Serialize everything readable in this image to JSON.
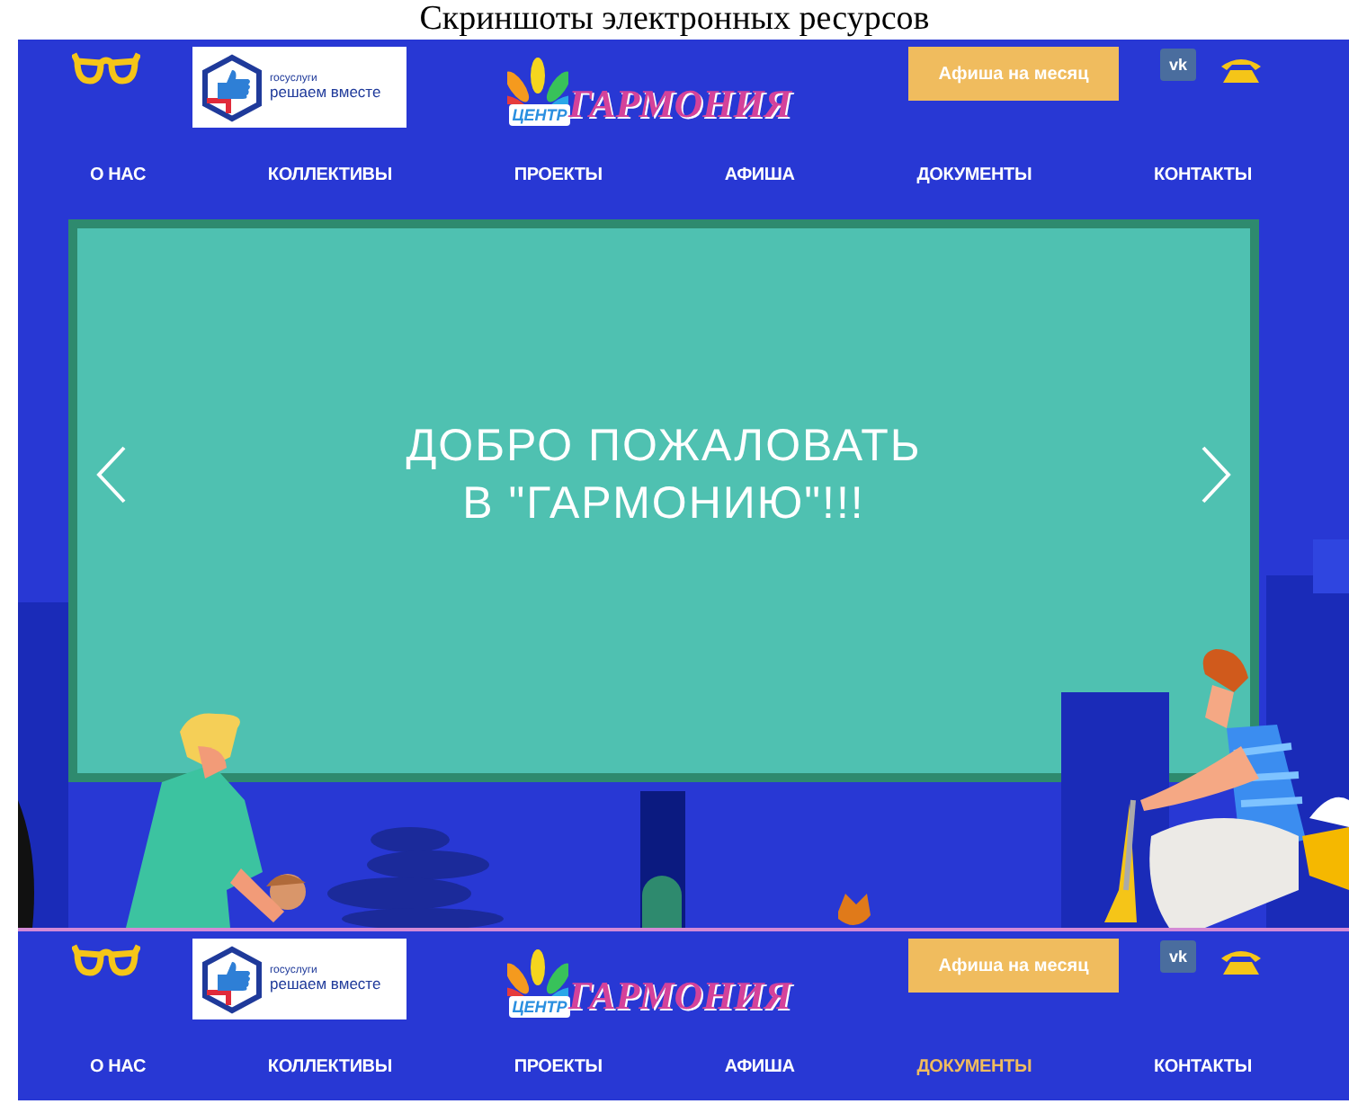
{
  "caption": "Скриншоты электронных ресурсов",
  "screenshots": [
    {
      "header": {
        "partner_logo": {
          "brand": "госуслуги",
          "slogan": "решаем вместе"
        },
        "site_logo": {
          "prefix": "ЦЕНТР",
          "name": "ГАРМОНИЯ"
        },
        "button": "Афиша на месяц",
        "social": "vk"
      },
      "nav": [
        {
          "label": "О НАС",
          "selected": false
        },
        {
          "label": "КОЛЛЕКТИВЫ",
          "selected": false
        },
        {
          "label": "ПРОЕКТЫ",
          "selected": false
        },
        {
          "label": "АФИША",
          "selected": false
        },
        {
          "label": "ДОКУМЕНТЫ",
          "selected": false
        },
        {
          "label": "КОНТАКТЫ",
          "selected": false
        }
      ],
      "banner": {
        "title_lines": [
          "ДОБРО ПОЖАЛОВАТЬ",
          "В \"ГАРМОНИЮ\"!!!"
        ]
      }
    },
    {
      "header": {
        "partner_logo": {
          "brand": "госуслуги",
          "slogan": "решаем вместе"
        },
        "site_logo": {
          "prefix": "ЦЕНТР",
          "name": "ГАРМОНИЯ"
        },
        "button": "Афиша на месяц",
        "social": "vk"
      },
      "nav": [
        {
          "label": "О НАС",
          "selected": false
        },
        {
          "label": "КОЛЛЕКТИВЫ",
          "selected": false
        },
        {
          "label": "ПРОЕКТЫ",
          "selected": false
        },
        {
          "label": "АФИША",
          "selected": false
        },
        {
          "label": "ДОКУМЕНТЫ",
          "selected": true
        },
        {
          "label": "КОНТАКТЫ",
          "selected": false
        }
      ]
    }
  ]
}
